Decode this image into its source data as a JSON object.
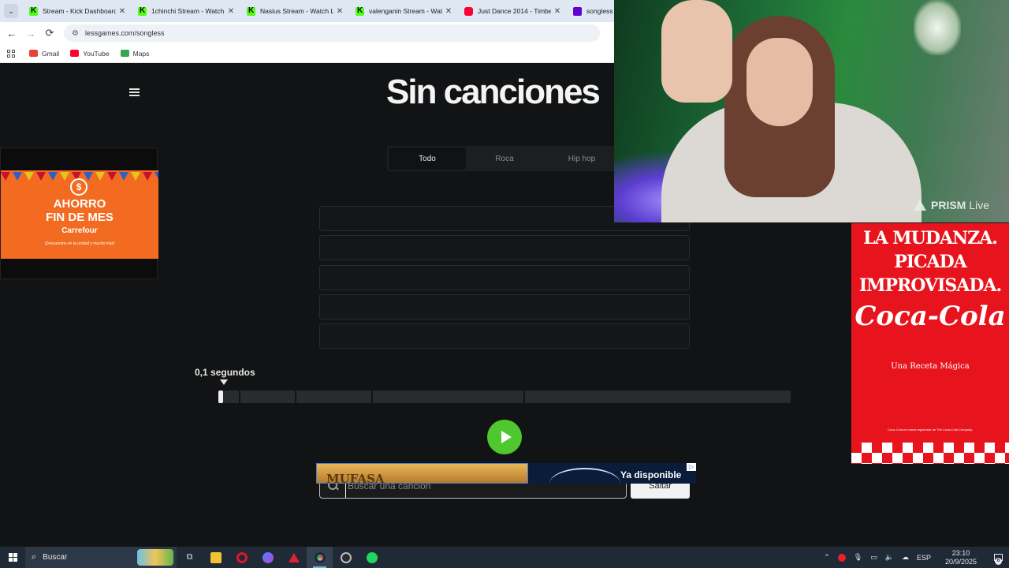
{
  "browser": {
    "tabs": [
      {
        "title": "Stream - Kick Dashboard",
        "icon": "kick-icon"
      },
      {
        "title": "1chinchi Stream - Watch Live",
        "icon": "kick-icon"
      },
      {
        "title": "Nasius Stream - Watch Live",
        "icon": "kick-icon"
      },
      {
        "title": "valenganin Stream - Watch",
        "icon": "kick-icon"
      },
      {
        "title": "Just Dance 2014 - Timber",
        "icon": "youtube-icon"
      },
      {
        "title": "songless g",
        "icon": "yahoo-icon"
      }
    ],
    "url": "lessgames.com/songless",
    "bookmarks": [
      {
        "label": "Gmail",
        "color": "#ea4335"
      },
      {
        "label": "YouTube",
        "color": "#ff0033"
      },
      {
        "label": "Maps",
        "color": "#34a853"
      }
    ]
  },
  "page": {
    "title": "Sin canciones",
    "genre_tabs": [
      {
        "label": "Todo",
        "active": true
      },
      {
        "label": "Roca",
        "active": false
      },
      {
        "label": "Hip hop",
        "active": false
      }
    ],
    "guess_slots": 5,
    "seconds_label": "0,1 segundos",
    "progress_fraction": 0.006,
    "segments_fraction": [
      0.036,
      0.134,
      0.267,
      0.533
    ],
    "search_placeholder": "Buscar una canción",
    "skip_label": "Saltar",
    "accent_color": "#4fc72f"
  },
  "ads": {
    "left": {
      "line1": "AHORRO",
      "line2": "FIN DE MES",
      "brand": "Carrefour",
      "fine": "¡Descuentos en la unidad y mucho más!"
    },
    "right": {
      "lines": [
        "LA MUDANZA.",
        "PICADA",
        "IMPROVISADA."
      ],
      "brand": "Coca-Cola",
      "sub": "Una Receta Mágica",
      "fine": "Coca-Cola es marca registrada de The Coca-Cola Company."
    },
    "bottom": {
      "poster_text": "MUFASA",
      "cta": "Ya disponible"
    }
  },
  "webcam": {
    "overlay_brand": "PRISM",
    "overlay_live": "Live"
  },
  "taskbar": {
    "search_label": "Buscar",
    "lang": "ESP",
    "time": "23:10",
    "date": "20/9/2025",
    "notifications": "6"
  }
}
